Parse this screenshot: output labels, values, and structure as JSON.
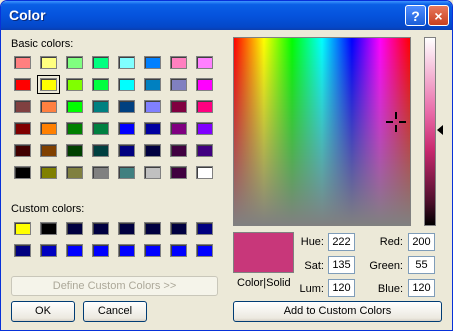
{
  "window": {
    "title": "Color",
    "help_glyph": "?",
    "close_glyph": "×"
  },
  "basic_colors_label": "Basic colors:",
  "custom_colors_label": "Custom colors:",
  "basic_colors": [
    [
      "#ff8080",
      "#ffff80",
      "#80ff80",
      "#00ff80",
      "#80ffff",
      "#0080ff",
      "#ff80c0",
      "#ff80ff"
    ],
    [
      "#ff0000",
      "#ffff00",
      "#80ff00",
      "#00ff40",
      "#00ffff",
      "#0080c0",
      "#8080c0",
      "#ff00ff"
    ],
    [
      "#804040",
      "#ff8040",
      "#00ff00",
      "#008080",
      "#004080",
      "#8080ff",
      "#800040",
      "#ff0080"
    ],
    [
      "#800000",
      "#ff8000",
      "#008000",
      "#008040",
      "#0000ff",
      "#0000a0",
      "#800080",
      "#8000ff"
    ],
    [
      "#400000",
      "#804000",
      "#004000",
      "#004040",
      "#000080",
      "#000040",
      "#400040",
      "#400080"
    ],
    [
      "#000000",
      "#808000",
      "#808040",
      "#808080",
      "#408080",
      "#c0c0c0",
      "#400040",
      "#ffffff"
    ]
  ],
  "selected_basic": "1,1",
  "custom_colors": [
    [
      "#ffff00",
      "#000000",
      "#000040",
      "#000040",
      "#000040",
      "#000040",
      "#000040",
      "#000080"
    ],
    [
      "#000080",
      "#0000c0",
      "#0000ff",
      "#0000ff",
      "#0000ff",
      "#0000ff",
      "#0000ff",
      "#0000ff"
    ]
  ],
  "define_button": "Define Custom Colors >>",
  "ok_button": "OK",
  "cancel_button": "Cancel",
  "add_button": "Add to Custom Colors",
  "color_solid_label": "Color|Solid",
  "preview_color": "#c8377a",
  "fields": {
    "hue": {
      "label": "Hue:",
      "value": "222"
    },
    "sat": {
      "label": "Sat:",
      "value": "135"
    },
    "lum": {
      "label": "Lum:",
      "value": "120"
    },
    "red": {
      "label": "Red:",
      "value": "200"
    },
    "green": {
      "label": "Green:",
      "value": "55"
    },
    "blue": {
      "label": "Blue:",
      "value": "120"
    }
  }
}
